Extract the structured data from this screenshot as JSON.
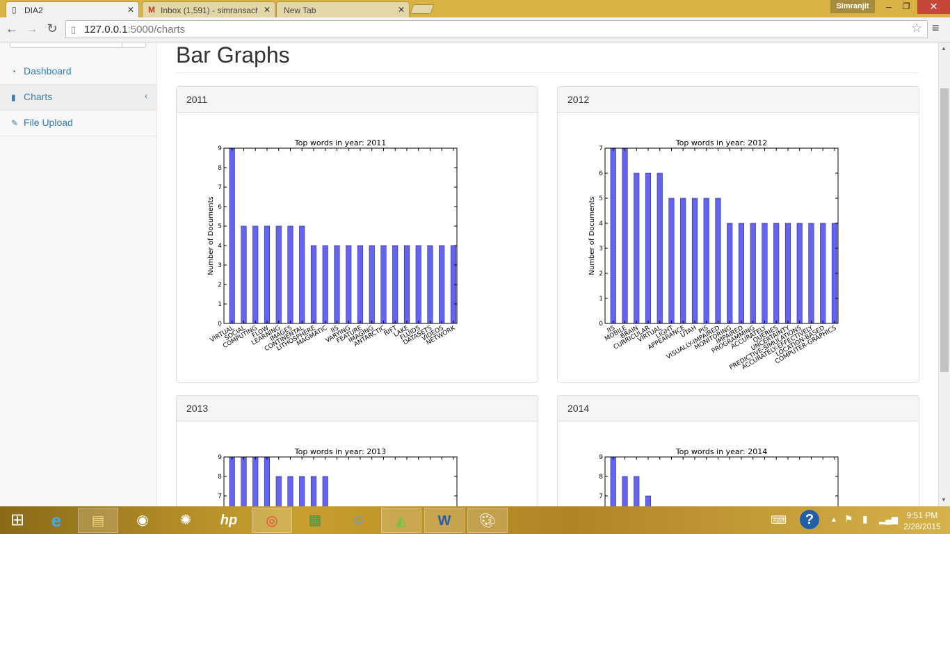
{
  "browser": {
    "tabs": [
      {
        "title": "DIA2",
        "active": true,
        "favicon": "page-icon"
      },
      {
        "title": "Inbox (1,591) - simransach",
        "active": false,
        "favicon": "gmail-icon"
      },
      {
        "title": "New Tab",
        "active": false,
        "favicon": ""
      }
    ],
    "profile_name": "Simranjit",
    "address_host": "127.0.0.1",
    "address_path": ":5000/charts"
  },
  "sidebar": {
    "items": [
      {
        "label": "Dashboard",
        "icon": "dashboard-icon",
        "active": false
      },
      {
        "label": "Charts",
        "icon": "bar-chart-icon",
        "active": true,
        "arrow": "‹"
      },
      {
        "label": "File Upload",
        "icon": "edit-icon",
        "active": false
      }
    ]
  },
  "main": {
    "title": "Bar Graphs",
    "panels": [
      {
        "heading": "2011"
      },
      {
        "heading": "2012"
      },
      {
        "heading": "2013"
      },
      {
        "heading": "2014"
      }
    ]
  },
  "taskbar": {
    "time": "9:51 PM",
    "date": "2/28/2015"
  },
  "colors": {
    "bar_fill": "#6464f0",
    "link": "#337ab7",
    "titlebar": "#d8b245"
  },
  "chart_data": [
    {
      "type": "bar",
      "title": "Top words in year: 2011",
      "ylabel": "Number of Documents",
      "xlabel": "",
      "ylim": [
        0,
        9
      ],
      "yticks": [
        0,
        1,
        2,
        3,
        4,
        5,
        6,
        7,
        8,
        9
      ],
      "categories": [
        "VIRTUAL",
        "SOCIAL",
        "COMPUTING",
        "FLOW",
        "LEARNING",
        "IMAGES",
        "CONTINENTAL",
        "LITHOSPHERE",
        "MAGMATIC",
        "IIS",
        "VARYING",
        "FEATURE",
        "IMAGING",
        "ANTARCTIC",
        "RIFT",
        "LAKE",
        "FLUIDS",
        "DATASETS",
        "VIDEOS",
        "NETWORK"
      ],
      "values": [
        9,
        5,
        5,
        5,
        5,
        5,
        5,
        4,
        4,
        4,
        4,
        4,
        4,
        4,
        4,
        4,
        4,
        4,
        4,
        4
      ]
    },
    {
      "type": "bar",
      "title": "Top words in year: 2012",
      "ylabel": "Number of Documents",
      "xlabel": "",
      "ylim": [
        0,
        7
      ],
      "yticks": [
        0,
        1,
        2,
        3,
        4,
        5,
        6,
        7
      ],
      "categories": [
        "IIS",
        "MOBILE",
        "BRAIN",
        "CURRICULAR",
        "VIRTUAL",
        "LIGHT",
        "APPEARANCE",
        "UTAH",
        "PIS",
        "VISUALLY-IMPAIRED",
        "MONITORING",
        "IMPAIRED",
        "PROGRAMMING",
        "ACCURATELY",
        "QUERIES",
        "UNCERTAINTY",
        "PREDICTIVE-SIMULATIONS",
        "ACCURATELY-EFFECTIVELY",
        "LOCATION-BASED",
        "COMPUTER-GRAPHICS"
      ],
      "values": [
        7,
        7,
        6,
        6,
        6,
        5,
        5,
        5,
        5,
        5,
        4,
        4,
        4,
        4,
        4,
        4,
        4,
        4,
        4,
        4
      ]
    },
    {
      "type": "bar",
      "title": "Top words in year: 2013",
      "ylabel": "",
      "xlabel": "",
      "ylim": [
        0,
        9
      ],
      "yticks": [
        7,
        8,
        9
      ],
      "categories": [],
      "values": [
        9,
        9,
        9,
        9,
        8,
        8,
        8,
        8,
        8
      ]
    },
    {
      "type": "bar",
      "title": "Top words in year: 2014",
      "ylabel": "",
      "xlabel": "",
      "ylim": [
        0,
        9
      ],
      "yticks": [
        7,
        8,
        9
      ],
      "categories": [],
      "values": [
        9,
        8,
        8,
        7
      ]
    }
  ]
}
